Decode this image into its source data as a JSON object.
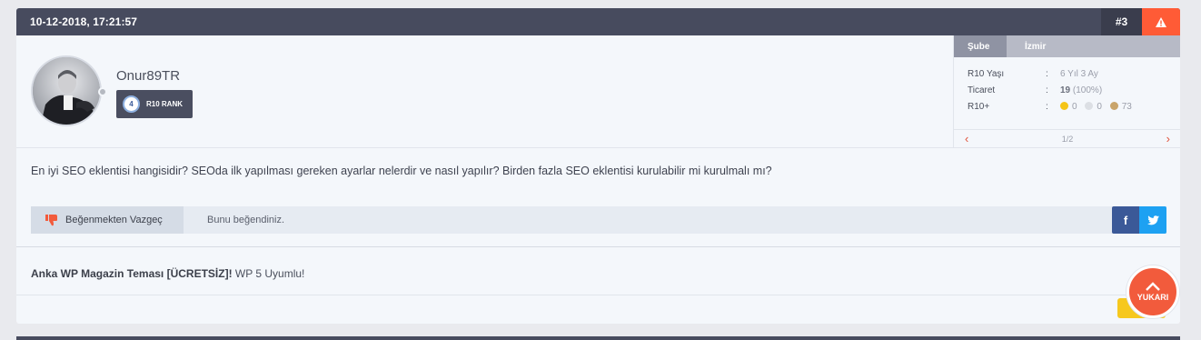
{
  "post": {
    "date": "10-12-2018, 17:21:57",
    "number": "#3",
    "report_icon": "warning-icon"
  },
  "user": {
    "username": "Onur89TR",
    "rank_level": "4",
    "rank_label": "R10 RANK",
    "status": "offline"
  },
  "info": {
    "tabs": [
      "Şube",
      "İzmir"
    ],
    "rows": [
      {
        "key": "R10 Yaşı",
        "value": "6 Yıl 3 Ay"
      },
      {
        "key": "Ticaret",
        "value_bold": "19",
        "value": "(100%)"
      },
      {
        "key": "R10+"
      }
    ],
    "colon": ":",
    "coins": [
      {
        "color": "#f5c518",
        "value": "0"
      },
      {
        "color": "#dcdfe4",
        "value": "0"
      },
      {
        "color": "#c9a46a",
        "value": "73"
      }
    ],
    "pager": "1/2",
    "prev_icon": "chevron-left-icon",
    "next_icon": "chevron-right-icon"
  },
  "body": {
    "text": "En iyi SEO eklentisi hangisidir? SEOda ilk yapılması gereken ayarlar nelerdir ve nasıl yapılır? Birden fazla SEO eklentisi kurulabilir mi kurulmalı mı?"
  },
  "like": {
    "button_label": "Beğenmekten Vazgeç",
    "status_text": "Bunu beğendiniz.",
    "facebook_label": "f"
  },
  "signature": {
    "bold": "Anka WP Magazin Teması [ÜCRETSİZ]!",
    "text": " WP 5 Uyumlu!"
  },
  "scroll_top": {
    "label": "YUKARI"
  },
  "colors": {
    "header": "#474b5e",
    "accent": "#ff5b36",
    "facebook": "#3b5998",
    "twitter": "#1da1f2"
  }
}
